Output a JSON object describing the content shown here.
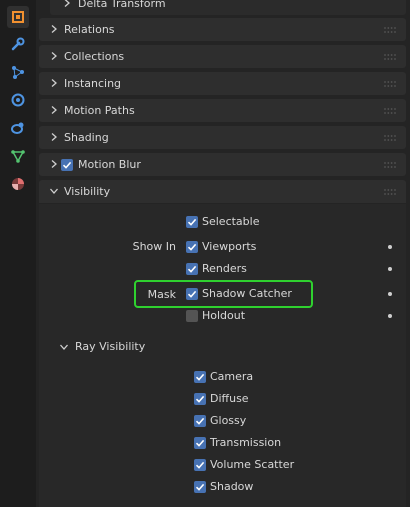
{
  "tabs": [
    {
      "name": "object-properties-icon",
      "color": "#f29130"
    },
    {
      "name": "modifier-wrench-icon",
      "color": "#4e94e2"
    },
    {
      "name": "particles-icon",
      "color": "#4e94e2"
    },
    {
      "name": "physics-icon",
      "color": "#4e94e2"
    },
    {
      "name": "constraints-icon",
      "color": "#4e94e2"
    },
    {
      "name": "object-data-mesh-icon",
      "color": "#54c470"
    },
    {
      "name": "material-icon",
      "color": "#e06f6f"
    }
  ],
  "panels": {
    "delta_transform": "Delta Transform",
    "relations": "Relations",
    "collections": "Collections",
    "instancing": "Instancing",
    "motion_paths": "Motion Paths",
    "shading": "Shading",
    "motion_blur": {
      "label": "Motion Blur",
      "checked": true
    },
    "visibility": "Visibility"
  },
  "visibility": {
    "selectable": {
      "label": "Selectable",
      "checked": true
    },
    "show_in_label": "Show In",
    "viewports": {
      "label": "Viewports",
      "checked": true
    },
    "renders": {
      "label": "Renders",
      "checked": true
    },
    "mask_label": "Mask",
    "shadow_catcher": {
      "label": "Shadow Catcher",
      "checked": true
    },
    "holdout": {
      "label": "Holdout",
      "checked": false
    }
  },
  "ray_visibility": {
    "title": "Ray Visibility",
    "items": [
      {
        "label": "Camera",
        "checked": true
      },
      {
        "label": "Diffuse",
        "checked": true
      },
      {
        "label": "Glossy",
        "checked": true
      },
      {
        "label": "Transmission",
        "checked": true
      },
      {
        "label": "Volume Scatter",
        "checked": true
      },
      {
        "label": "Shadow",
        "checked": true
      }
    ]
  },
  "colors": {
    "checkbox_on": "#4772b3",
    "highlight_border": "#2fd12f"
  }
}
